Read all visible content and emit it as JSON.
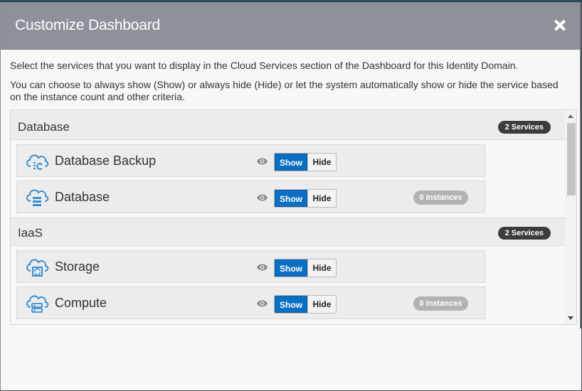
{
  "dialog": {
    "title": "Customize Dashboard",
    "intro_line1": "Select the services that you want to display in the Cloud Services section of the Dashboard for this Identity Domain.",
    "intro_line2": "You can choose to always show (Show) or always hide (Hide) or let the system automatically show or hide the service based on the instance count and other criteria."
  },
  "sections": [
    {
      "title": "Database",
      "badge": "2 Services",
      "services": [
        {
          "name": "Database Backup",
          "icon": "cloud-backup-icon",
          "show_label": "Show",
          "hide_label": "Hide",
          "selected": "Show",
          "instances": ""
        },
        {
          "name": "Database",
          "icon": "cloud-database-icon",
          "show_label": "Show",
          "hide_label": "Hide",
          "selected": "Show",
          "instances": "0 Instances"
        }
      ]
    },
    {
      "title": "IaaS",
      "badge": "2 Services",
      "services": [
        {
          "name": "Storage",
          "icon": "cloud-storage-icon",
          "show_label": "Show",
          "hide_label": "Hide",
          "selected": "Show",
          "instances": ""
        },
        {
          "name": "Compute",
          "icon": "cloud-compute-icon",
          "show_label": "Show",
          "hide_label": "Hide",
          "selected": "Show",
          "instances": "0 Instances"
        }
      ]
    }
  ],
  "colors": {
    "header_bg": "#8e9199",
    "accent_blue": "#0a6fc2",
    "icon_blue": "#3a8fd0",
    "badge_dark": "#3c3c3c",
    "instances_gray": "#b3b3b3"
  }
}
